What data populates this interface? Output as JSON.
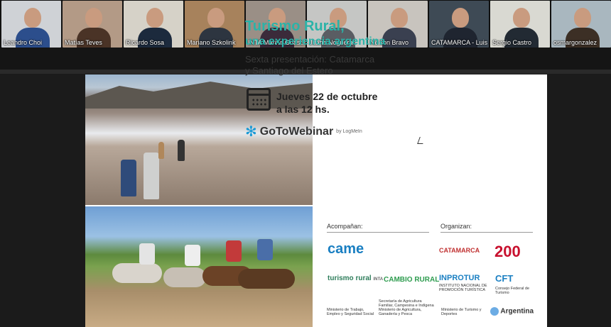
{
  "participants": [
    {
      "name": "Leandro Choi",
      "bg": "#cfd2d6",
      "shirt": "#2c4e8c"
    },
    {
      "name": "Matías Teves",
      "bg": "#b39a86",
      "shirt": "#4a3326"
    },
    {
      "name": "Ricardo Sosa",
      "bg": "#d6d2c8",
      "shirt": "#1c2a3d"
    },
    {
      "name": "Mariano Szkolink",
      "bg": "#a7825c",
      "shirt": "#2d3540"
    },
    {
      "name": "INTA Marina Guast...",
      "bg": "#9a8f86",
      "shirt": "#3b2b3a"
    },
    {
      "name": "Juana Noguera",
      "bg": "#c5c6c4",
      "shirt": "#5a5d63"
    },
    {
      "name": "Nelson Bravo",
      "bg": "#c8c4be",
      "shirt": "#3a4050"
    },
    {
      "name": "CATAMARCA - Luis ...",
      "bg": "#3e4a55",
      "shirt": "#1f2530"
    },
    {
      "name": "Sergio Castro",
      "bg": "#d9d9d2",
      "shirt": "#222a33",
      "active": true
    },
    {
      "name": "osmargonzalez",
      "bg": "#a9b7bf",
      "shirt": "#3c2f25"
    }
  ],
  "slide": {
    "title_line1": "Turismo Rural,",
    "title_line2": "una experiencia argentina",
    "subtitle_line1": "Sexta presentación: Catamarca",
    "subtitle_line2": "y Santiago del Estero",
    "date_line1": "Jueves 22 de octubre",
    "date_line2": "a las 12 hs.",
    "webinar_brand": "GoToWebinar",
    "webinar_by": "by LogMeIn",
    "accompany_label": "Acompañan:",
    "organize_label": "Organizan:",
    "logos": {
      "came": "came",
      "catamarca": "CATAMARCA",
      "anniv": "200",
      "turismo_rural": "turismo rural",
      "inta": "INTA",
      "cambio_rural": "CAMBIO RURAL",
      "inprotur": "INPROTUR",
      "inprotur_sub": "INSTITUTO NACIONAL DE PROMOCIÓN TURÍSTICA",
      "cft": "CFT",
      "cft_sub": "Consejo Federal de Turismo",
      "argentina": "Argentina",
      "min_trabajo": "Ministerio de Trabajo, Empleo y Seguridad Social",
      "min_agri": "Secretaría de Agricultura Familiar, Campesina e Indígena Ministerio de Agricultura, Ganadería y Pesca",
      "min_turismo": "Ministerio de Turismo y Deportes"
    }
  },
  "colors": {
    "accent": "#2bb3a8",
    "came": "#1a7fc2",
    "active_border": "#3fbf6f"
  }
}
